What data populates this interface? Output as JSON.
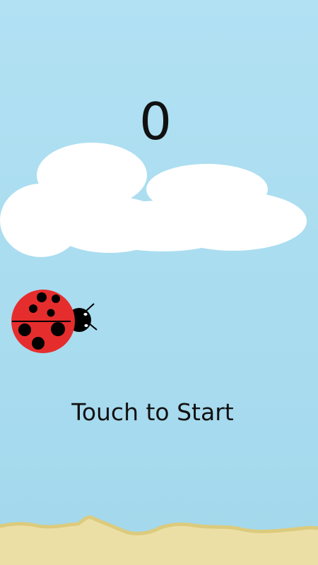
{
  "game": {
    "score": "0",
    "start_prompt": "Touch to Start"
  },
  "colors": {
    "sky_top": "#b1e1f3",
    "sky_bottom": "#a3d8ec",
    "cloud": "#ffffff",
    "ladybug_body": "#e62d2d",
    "ladybug_spots": "#000000",
    "ground_sand": "#ecdfa6",
    "ground_edge": "#dccb7d",
    "text": "#111111"
  },
  "icons": {
    "player": "ladybug-icon",
    "background": "cloud-icon"
  }
}
